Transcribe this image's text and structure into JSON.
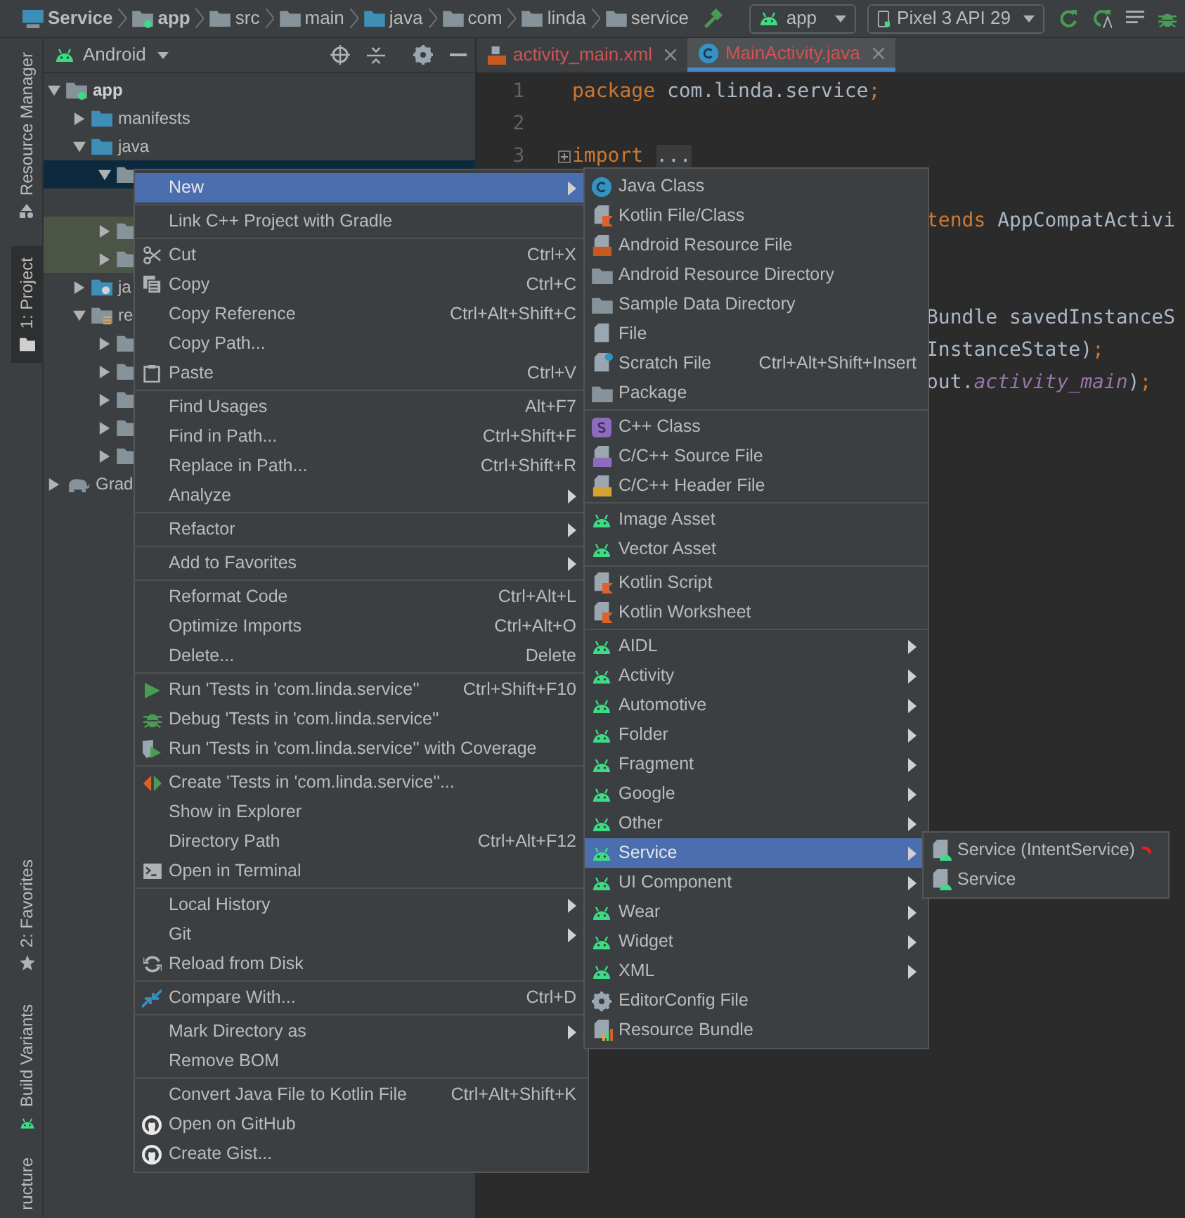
{
  "breadcrumbs": [
    {
      "label": "Service",
      "kind": "project"
    },
    {
      "label": "app",
      "kind": "module"
    },
    {
      "label": "src",
      "kind": "folder"
    },
    {
      "label": "main",
      "kind": "folder"
    },
    {
      "label": "java",
      "kind": "source"
    },
    {
      "label": "com",
      "kind": "package"
    },
    {
      "label": "linda",
      "kind": "package"
    },
    {
      "label": "service",
      "kind": "package"
    }
  ],
  "toolbar": {
    "run_config": "app",
    "device": "Pixel 3 API 29"
  },
  "tool_stripe": [
    {
      "label": "Resource Manager",
      "selected": false,
      "kind": "resources"
    },
    {
      "label": "1: Project",
      "selected": true,
      "kind": "project"
    },
    {
      "label": "2: Favorites",
      "selected": false,
      "kind": "favorites"
    },
    {
      "label": "Build Variants",
      "selected": false,
      "kind": "variants"
    },
    {
      "label": "ructure",
      "selected": false,
      "kind": "structure"
    }
  ],
  "project_panel": {
    "view": "Android",
    "tree": [
      {
        "label": "app",
        "kind": "module",
        "expanded": true,
        "selected": false,
        "children": [
          {
            "label": "manifests",
            "kind": "folder",
            "expanded": false,
            "selected": false
          },
          {
            "label": "java",
            "kind": "folder",
            "expanded": true,
            "selected": false,
            "children": [
              {
                "kind": "package",
                "expanded": true,
                "selected": true
              },
              {
                "kind": "test_package",
                "expanded": false,
                "selected": false
              },
              {
                "kind": "test_package",
                "expanded": false,
                "selected": false
              }
            ]
          },
          {
            "label": "ja",
            "kind": "generated",
            "expanded": false,
            "selected": false
          },
          {
            "label": "re",
            "kind": "res",
            "expanded": true,
            "selected": false,
            "children": [
              {
                "kind": "package",
                "expanded": false,
                "selected": false
              },
              {
                "kind": "package",
                "expanded": false,
                "selected": false
              },
              {
                "kind": "package",
                "expanded": false,
                "selected": false
              },
              {
                "kind": "package",
                "expanded": false,
                "selected": false
              },
              {
                "kind": "package",
                "expanded": false,
                "selected": false
              }
            ]
          }
        ]
      },
      {
        "label": "Grad",
        "kind": "gradle",
        "expanded": false,
        "selected": false
      }
    ]
  },
  "editor": {
    "tabs": [
      {
        "label": "activity_main.xml",
        "kind": "xml",
        "selected": false
      },
      {
        "label": "MainActivity.java",
        "kind": "java",
        "selected": true
      }
    ],
    "lines": [
      {
        "kind": "line",
        "number": "1",
        "tokens": [
          {
            "text": "package",
            "kind": "keyword"
          },
          {
            "text": " com.linda.service",
            "kind": "plain"
          },
          {
            "text": ";",
            "kind": "keyword"
          }
        ]
      },
      {
        "kind": "line",
        "number": "2"
      },
      {
        "kind": "line",
        "number": "3",
        "folded": true,
        "tokens": [
          {
            "text": "import",
            "kind": "keyword"
          },
          {
            "text": "...",
            "kind": "fold"
          }
        ]
      },
      {
        "kind": "hidden"
      },
      {
        "kind": "fragment",
        "tokens": [
          {
            "text": "tends",
            "kind": "keyword"
          },
          {
            "text": " AppCompatActivi",
            "kind": "plain"
          }
        ]
      },
      {
        "kind": "hidden"
      },
      {
        "kind": "hidden"
      },
      {
        "kind": "fragment",
        "tokens": [
          {
            "text": "Bundle savedInstanceS",
            "kind": "plain"
          }
        ]
      },
      {
        "kind": "fragment",
        "tokens": [
          {
            "text": "InstanceState)",
            "kind": "plain"
          },
          {
            "text": ";",
            "kind": "keyword"
          }
        ]
      },
      {
        "kind": "fragment",
        "tokens": [
          {
            "text": "out.",
            "kind": "plain"
          },
          {
            "text": "activity_main",
            "kind": "field"
          },
          {
            "text": ")",
            "kind": "plain"
          },
          {
            "text": ";",
            "kind": "keyword"
          }
        ]
      }
    ]
  },
  "context_menu": {
    "groups": [
      {
        "items": [
          {
            "label": "New",
            "submenu": true,
            "selected": true
          }
        ]
      },
      {
        "items": [
          {
            "label": "Link C++ Project with Gradle",
            "selected": false
          }
        ]
      },
      {
        "items": [
          {
            "label": "Cut",
            "kind": "scissors",
            "shortcut": "Ctrl+X",
            "selected": false
          },
          {
            "label": "Copy",
            "kind": "copy",
            "shortcut": "Ctrl+C",
            "selected": false
          },
          {
            "label": "Copy Reference",
            "shortcut": "Ctrl+Alt+Shift+C",
            "selected": false
          },
          {
            "label": "Copy Path...",
            "selected": false
          },
          {
            "label": "Paste",
            "kind": "paste",
            "shortcut": "Ctrl+V",
            "selected": false
          }
        ]
      },
      {
        "items": [
          {
            "label": "Find Usages",
            "shortcut": "Alt+F7",
            "selected": false
          },
          {
            "label": "Find in Path...",
            "shortcut": "Ctrl+Shift+F",
            "selected": false
          },
          {
            "label": "Replace in Path...",
            "shortcut": "Ctrl+Shift+R",
            "selected": false
          },
          {
            "label": "Analyze",
            "submenu": true,
            "selected": false
          }
        ]
      },
      {
        "items": [
          {
            "label": "Refactor",
            "submenu": true,
            "selected": false
          }
        ]
      },
      {
        "items": [
          {
            "label": "Add to Favorites",
            "submenu": true,
            "selected": false
          }
        ]
      },
      {
        "items": [
          {
            "label": "Reformat Code",
            "shortcut": "Ctrl+Alt+L",
            "selected": false
          },
          {
            "label": "Optimize Imports",
            "shortcut": "Ctrl+Alt+O",
            "selected": false
          },
          {
            "label": "Delete...",
            "shortcut": "Delete",
            "selected": false
          }
        ]
      },
      {
        "items": [
          {
            "label": "Run 'Tests in 'com.linda.service''",
            "kind": "run",
            "shortcut": "Ctrl+Shift+F10",
            "selected": false
          },
          {
            "label": "Debug 'Tests in 'com.linda.service''",
            "kind": "debug",
            "selected": false
          },
          {
            "label": "Run 'Tests in 'com.linda.service'' with Coverage",
            "kind": "coverage",
            "selected": false
          }
        ]
      },
      {
        "items": [
          {
            "label": "Create 'Tests in 'com.linda.service''...",
            "kind": "create_test",
            "selected": false
          },
          {
            "label": "Show in Explorer",
            "selected": false
          },
          {
            "label": "Directory Path",
            "shortcut": "Ctrl+Alt+F12",
            "selected": false
          },
          {
            "label": "Open in Terminal",
            "kind": "terminal",
            "selected": false
          }
        ]
      },
      {
        "items": [
          {
            "label": "Local History",
            "submenu": true,
            "selected": false
          },
          {
            "label": "Git",
            "submenu": true,
            "selected": false
          },
          {
            "label": "Reload from Disk",
            "kind": "reload",
            "selected": false
          }
        ]
      },
      {
        "items": [
          {
            "label": "Compare With...",
            "kind": "compare",
            "shortcut": "Ctrl+D",
            "selected": false
          }
        ]
      },
      {
        "items": [
          {
            "label": "Mark Directory as",
            "submenu": true,
            "selected": false
          },
          {
            "label": "Remove BOM",
            "selected": false
          }
        ]
      },
      {
        "items": [
          {
            "label": "Convert Java File to Kotlin File",
            "shortcut": "Ctrl+Alt+Shift+K",
            "selected": false
          },
          {
            "label": "Open on GitHub",
            "kind": "github",
            "selected": false
          },
          {
            "label": "Create Gist...",
            "kind": "github",
            "selected": false
          }
        ]
      }
    ]
  },
  "new_submenu": {
    "groups": [
      {
        "items": [
          {
            "label": "Java Class",
            "kind": "java_class",
            "selected": false
          },
          {
            "label": "Kotlin File/Class",
            "kind": "kotlin",
            "selected": false
          },
          {
            "label": "Android Resource File",
            "kind": "resource_file",
            "selected": false
          },
          {
            "label": "Android Resource Directory",
            "kind": "folder",
            "selected": false
          },
          {
            "label": "Sample Data Directory",
            "kind": "folder",
            "selected": false
          },
          {
            "label": "File",
            "kind": "file",
            "selected": false
          },
          {
            "label": "Scratch File",
            "kind": "scratch",
            "shortcut": "Ctrl+Alt+Shift+Insert",
            "selected": false
          },
          {
            "label": "Package",
            "kind": "package",
            "selected": false
          }
        ]
      },
      {
        "items": [
          {
            "label": "C++ Class",
            "kind": "cpp_class",
            "selected": false
          },
          {
            "label": "C/C++ Source File",
            "kind": "cpp_source",
            "selected": false
          },
          {
            "label": "C/C++ Header File",
            "kind": "cpp_header",
            "selected": false
          }
        ]
      },
      {
        "items": [
          {
            "label": "Image Asset",
            "kind": "android",
            "selected": false
          },
          {
            "label": "Vector Asset",
            "kind": "android",
            "selected": false
          }
        ]
      },
      {
        "items": [
          {
            "label": "Kotlin Script",
            "kind": "kotlin",
            "selected": false
          },
          {
            "label": "Kotlin Worksheet",
            "kind": "kotlin",
            "selected": false
          }
        ]
      },
      {
        "items": [
          {
            "label": "AIDL",
            "kind": "android",
            "submenu": true,
            "selected": false
          },
          {
            "label": "Activity",
            "kind": "android",
            "submenu": true,
            "selected": false
          },
          {
            "label": "Automotive",
            "kind": "android",
            "submenu": true,
            "selected": false
          },
          {
            "label": "Folder",
            "kind": "android",
            "submenu": true,
            "selected": false
          },
          {
            "label": "Fragment",
            "kind": "android",
            "submenu": true,
            "selected": false
          },
          {
            "label": "Google",
            "kind": "android",
            "submenu": true,
            "selected": false
          },
          {
            "label": "Other",
            "kind": "android",
            "submenu": true,
            "selected": false
          },
          {
            "label": "Service",
            "kind": "android",
            "submenu": true,
            "selected": true
          },
          {
            "label": "UI Component",
            "kind": "android",
            "submenu": true,
            "selected": false
          },
          {
            "label": "Wear",
            "kind": "android",
            "submenu": true,
            "selected": false
          },
          {
            "label": "Widget",
            "kind": "android",
            "submenu": true,
            "selected": false
          },
          {
            "label": "XML",
            "kind": "android",
            "submenu": true,
            "selected": false
          },
          {
            "label": "EditorConfig File",
            "kind": "gear",
            "selected": false
          },
          {
            "label": "Resource Bundle",
            "kind": "bundle",
            "selected": false
          }
        ]
      }
    ]
  },
  "service_submenu": {
    "groups": [
      {
        "items": [
          {
            "label": "Service (IntentService)",
            "kind": "android_file",
            "selected": false,
            "marked": true
          },
          {
            "label": "Service",
            "kind": "android_file",
            "selected": false,
            "marked": false
          }
        ]
      }
    ]
  }
}
